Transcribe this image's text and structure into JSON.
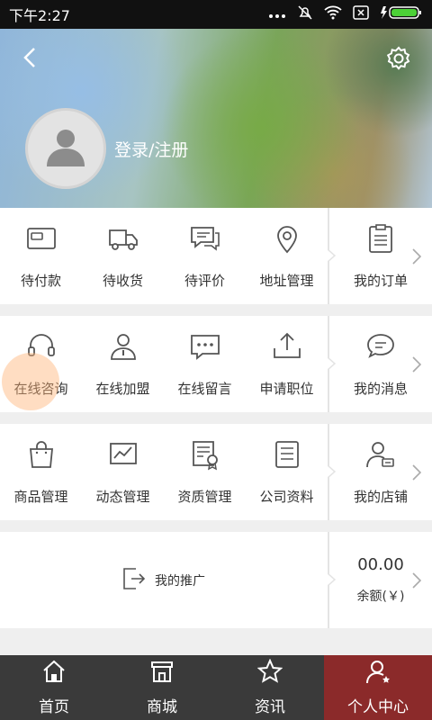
{
  "status": {
    "time": "下午2:27"
  },
  "profile": {
    "login_text": "登录/注册"
  },
  "orders": {
    "items": [
      {
        "label": "待付款",
        "icon": "wallet-icon"
      },
      {
        "label": "待收货",
        "icon": "truck-icon"
      },
      {
        "label": "待评价",
        "icon": "comment-icon"
      },
      {
        "label": "地址管理",
        "icon": "location-pin-icon"
      }
    ],
    "side": {
      "label": "我的订单",
      "icon": "clipboard-icon"
    }
  },
  "services": {
    "items": [
      {
        "label": "在线咨询",
        "icon": "headset-icon"
      },
      {
        "label": "在线加盟",
        "icon": "user-join-icon"
      },
      {
        "label": "在线留言",
        "icon": "chat-bubble-icon"
      },
      {
        "label": "申请职位",
        "icon": "upload-icon"
      }
    ],
    "side": {
      "label": "我的消息",
      "icon": "message-icon"
    }
  },
  "manage": {
    "items": [
      {
        "label": "商品管理",
        "icon": "shopping-bag-icon"
      },
      {
        "label": "动态管理",
        "icon": "chart-icon"
      },
      {
        "label": "资质管理",
        "icon": "certificate-icon"
      },
      {
        "label": "公司资料",
        "icon": "document-list-icon"
      }
    ],
    "side": {
      "label": "我的店铺",
      "icon": "shop-owner-icon"
    }
  },
  "promotion": {
    "label": "我的推广",
    "amount": "00.00",
    "balance_label": "余额(￥)"
  },
  "tabs": [
    {
      "label": "首页",
      "icon": "home-icon"
    },
    {
      "label": "商城",
      "icon": "store-icon"
    },
    {
      "label": "资讯",
      "icon": "star-icon"
    },
    {
      "label": "个人中心",
      "icon": "user-center-icon"
    }
  ],
  "colors": {
    "accent": "#8b2a2a",
    "tabbar_bg": "#3a3a3a"
  }
}
